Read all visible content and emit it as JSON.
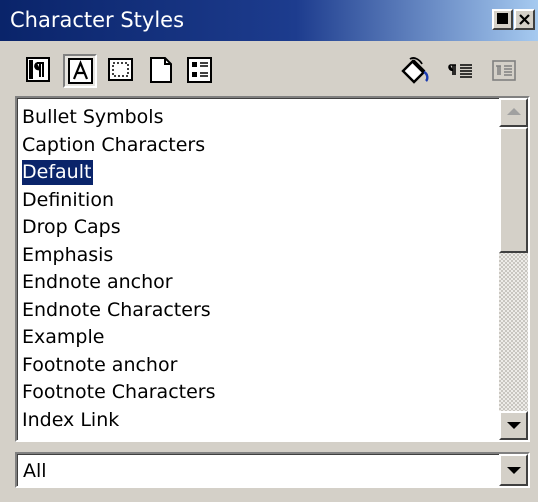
{
  "window": {
    "title": "Character Styles"
  },
  "titlebar_buttons": [
    {
      "name": "minimize-icon"
    },
    {
      "name": "close-icon"
    }
  ],
  "toolbar": {
    "tools": [
      {
        "name": "paragraph-styles-icon",
        "pressed": false
      },
      {
        "name": "character-styles-icon",
        "pressed": true
      },
      {
        "name": "frame-styles-icon",
        "pressed": false
      },
      {
        "name": "page-styles-icon",
        "pressed": false
      },
      {
        "name": "list-styles-icon",
        "pressed": false
      }
    ],
    "actions": [
      {
        "name": "fill-format-mode-icon"
      },
      {
        "name": "new-style-from-selection-icon"
      },
      {
        "name": "update-style-icon",
        "disabled": true
      }
    ]
  },
  "styles_list": {
    "items": [
      "Bullet Symbols",
      "Caption Characters",
      "Default",
      "Definition",
      "Drop Caps",
      "Emphasis",
      "Endnote anchor",
      "Endnote Characters",
      "Example",
      "Footnote anchor",
      "Footnote Characters",
      "Index Link"
    ],
    "selected": "Default"
  },
  "filter": {
    "value": "All"
  },
  "colors": {
    "selection": "#0a246a",
    "titlebar": "#0a246a",
    "face": "#d4d0c8"
  }
}
